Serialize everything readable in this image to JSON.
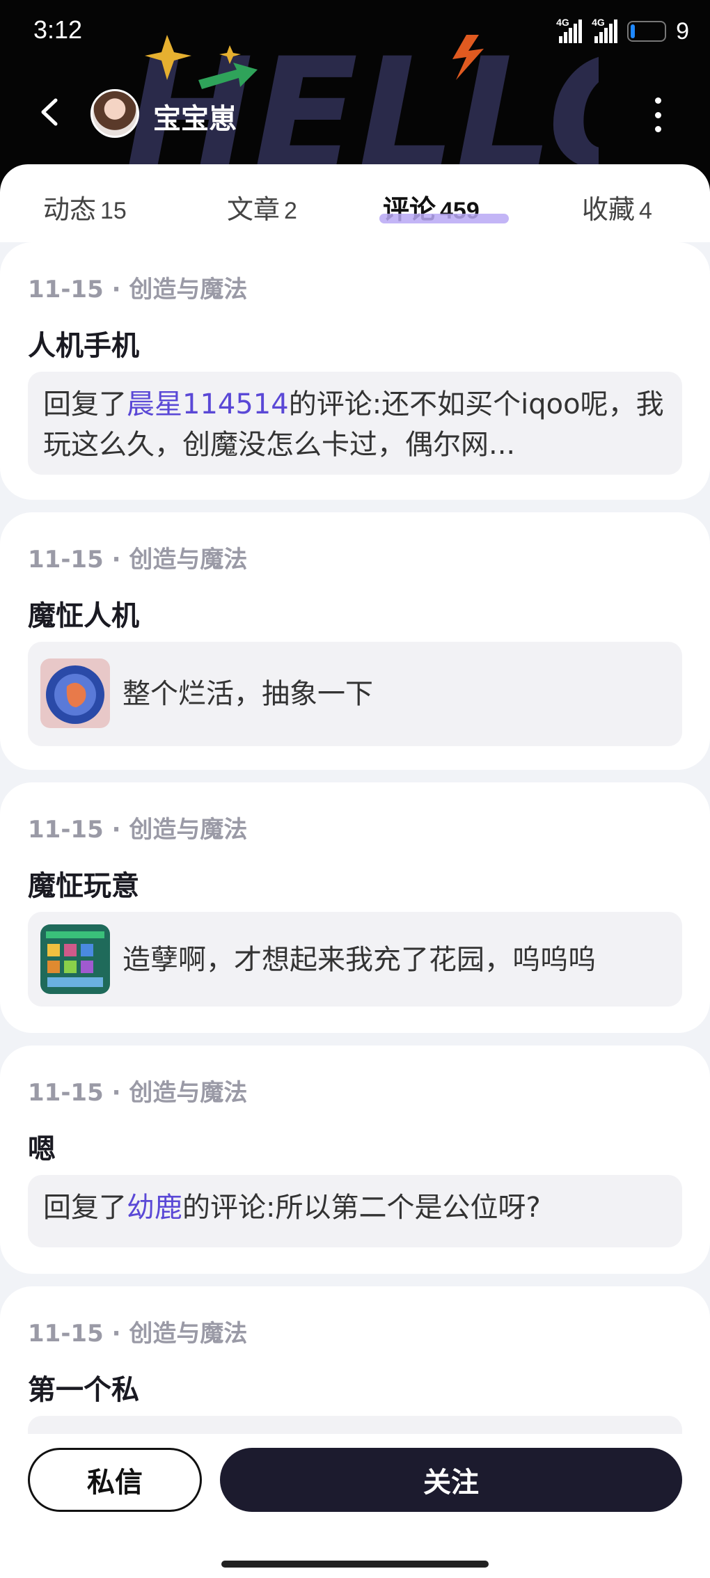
{
  "status_bar": {
    "time": "3:12",
    "network_1": "4G",
    "network_2": "4G",
    "battery": "9"
  },
  "header": {
    "username": "宝宝崽",
    "background_text": "HELLO"
  },
  "tabs": [
    {
      "label": "动态",
      "count": "15"
    },
    {
      "label": "文章",
      "count": "2"
    },
    {
      "label": "评论",
      "count": "459",
      "active": true
    },
    {
      "label": "收藏",
      "count": "4"
    }
  ],
  "comments": [
    {
      "meta": "11-15 · 创造与魔法",
      "title": "人机手机",
      "reply_prefix": "回复了",
      "mention": "晨星114514",
      "reply_rest": "的评论:还不如买个iqoo呢，我玩这么久，创魔没怎么卡过，偶尔网..."
    },
    {
      "meta": "11-15 · 创造与魔法",
      "title": "魔怔人机",
      "text": "整个烂活，抽象一下"
    },
    {
      "meta": "11-15 · 创造与魔法",
      "title": "魔怔玩意",
      "text": "造孽啊，才想起来我充了花园，呜呜呜"
    },
    {
      "meta": "11-15 · 创造与魔法",
      "title": "嗯",
      "reply_prefix": "回复了",
      "mention": "幼鹿",
      "reply_rest": "的评论:所以第二个是公位呀?"
    },
    {
      "meta": "11-15 · 创造与魔法",
      "title": "第一个私"
    }
  ],
  "actions": {
    "message_label": "私信",
    "follow_label": "关注"
  },
  "colors": {
    "mention": "#5a48d6",
    "tab_underline": "#b8a8f4",
    "follow_bg": "#1c1b2e"
  }
}
